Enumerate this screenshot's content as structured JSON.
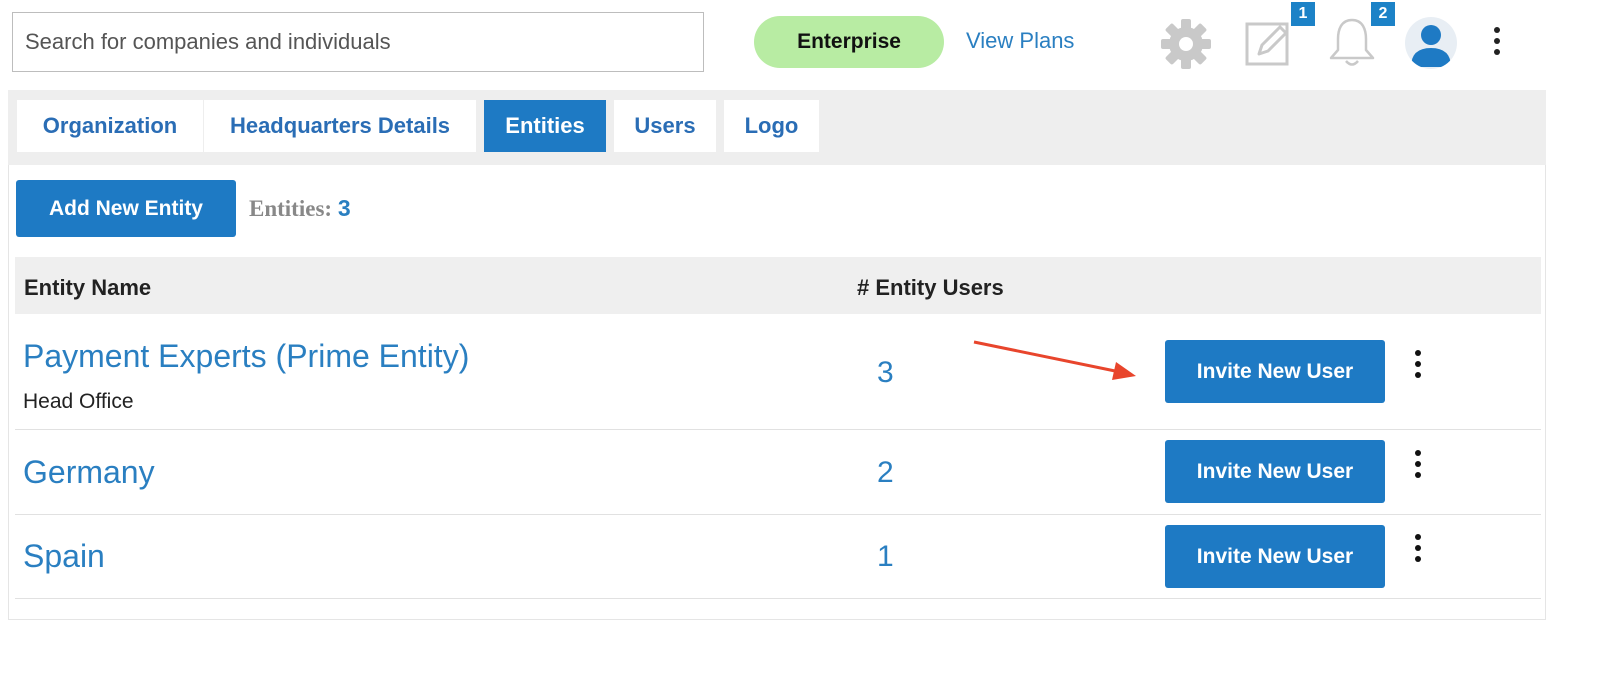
{
  "search": {
    "placeholder": "Search for companies and individuals",
    "value": ""
  },
  "header": {
    "plan_badge": "Enterprise",
    "view_plans": "View Plans",
    "tasks_count": "1",
    "notifications_count": "2"
  },
  "tabs": [
    {
      "label": "Organization",
      "active": false
    },
    {
      "label": "Headquarters Details",
      "active": false
    },
    {
      "label": "Entities",
      "active": true
    },
    {
      "label": "Users",
      "active": false
    },
    {
      "label": "Logo",
      "active": false
    }
  ],
  "toolbar": {
    "add_button": "Add New Entity",
    "count_label": "Entities:",
    "count_value": "3"
  },
  "table": {
    "columns": [
      "Entity Name",
      "# Entity Users"
    ],
    "rows": [
      {
        "name": "Payment Experts (Prime Entity)",
        "subtitle": "Head Office",
        "users": "3",
        "action": "Invite New User"
      },
      {
        "name": "Germany",
        "subtitle": "",
        "users": "2",
        "action": "Invite New User"
      },
      {
        "name": "Spain",
        "subtitle": "",
        "users": "1",
        "action": "Invite New User"
      }
    ]
  },
  "icons": {
    "settings": "gear-icon",
    "tasks": "edit-icon",
    "notifications": "bell-icon",
    "profile": "user-avatar-icon",
    "more": "kebab-menu-icon"
  },
  "colors": {
    "primary": "#1e7ac4",
    "link": "#2a7fc1",
    "plan_badge": "#b8eca3",
    "badge": "#1c82c7",
    "annotation_arrow": "#e8452c"
  }
}
